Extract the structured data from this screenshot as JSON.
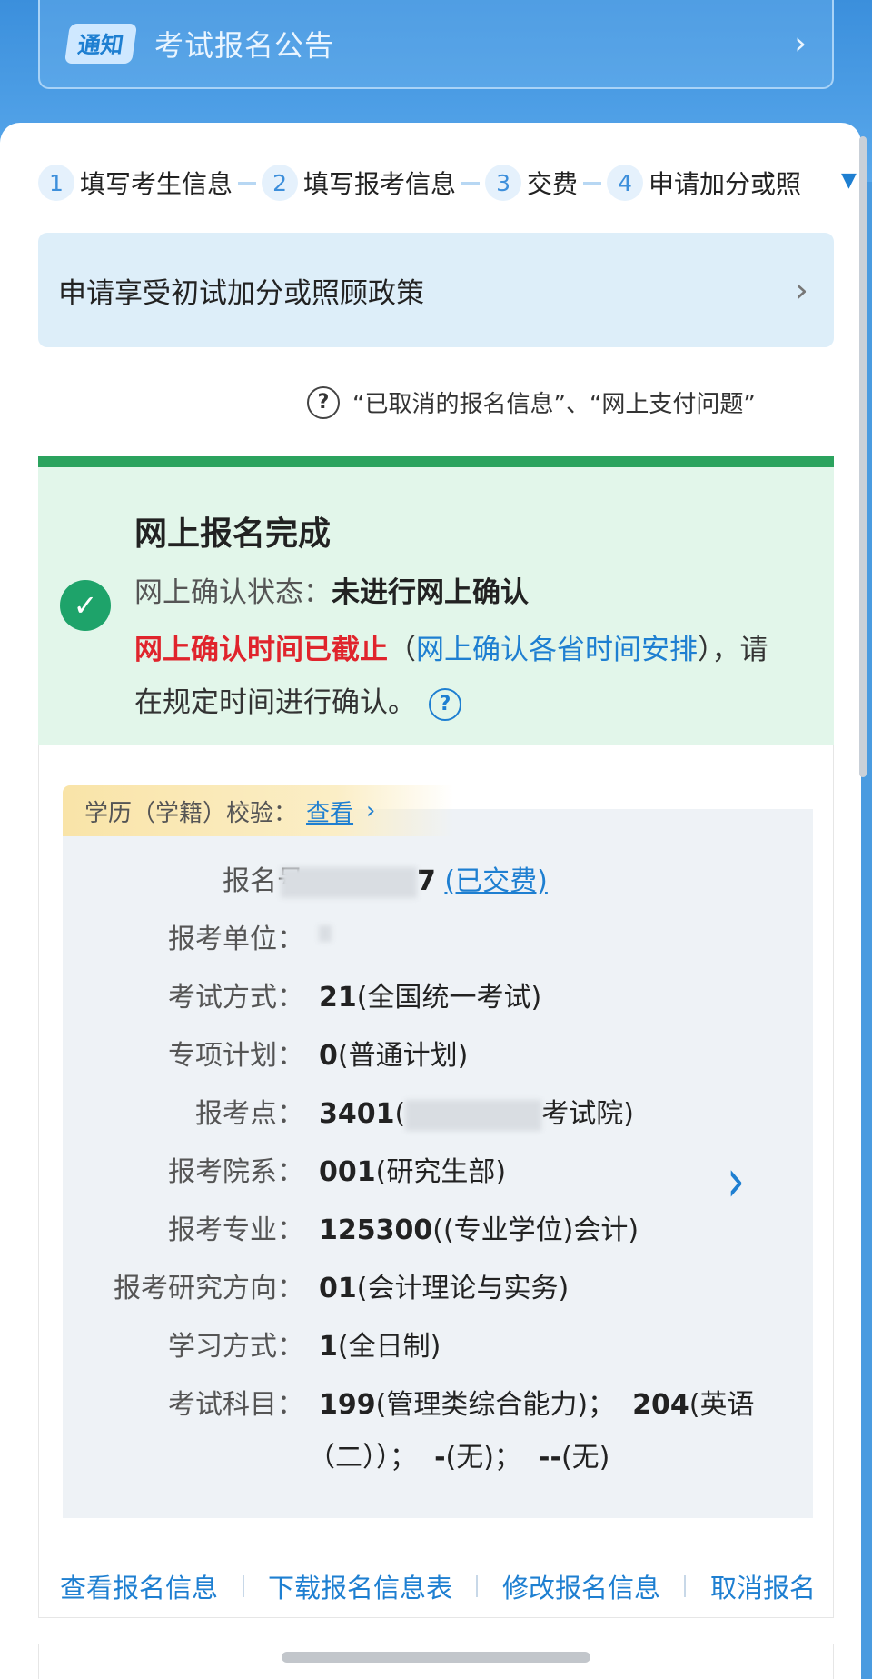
{
  "notice": {
    "tag": "通知",
    "text": "考试报名公告",
    "icon": "chevron-right-icon"
  },
  "steps": [
    {
      "num": "1",
      "label": "填写考生信息"
    },
    {
      "num": "2",
      "label": "填写报考信息"
    },
    {
      "num": "3",
      "label": "交费"
    },
    {
      "num": "4",
      "label": "申请加分或照"
    }
  ],
  "policy": {
    "text": "申请享受初试加分或照顾政策"
  },
  "help": {
    "text": "“已取消的报名信息”、“网上支付问题”"
  },
  "status": {
    "title": "网上报名完成",
    "confirm_label": "网上确认状态：",
    "confirm_value": "未进行网上确认",
    "warning": "网上确认时间已截止",
    "warn_open": "（",
    "schedule_link": "网上确认各省时间安排",
    "warn_rest": "），请在规定时间进行确认。",
    "accent": "#2ba35e",
    "warn_color": "#e0242c"
  },
  "verify": {
    "label": "学历（学籍）校验：",
    "link": "查看"
  },
  "fields": {
    "reg_no": {
      "label": "报名号",
      "tail": "7",
      "paid": "(已交费)"
    },
    "unit": {
      "label": "报考单位："
    },
    "exam_mode": {
      "label": "考试方式：",
      "code": "21",
      "text": "(全国统一考试)"
    },
    "plan": {
      "label": "专项计划：",
      "code": "0",
      "text": "(普通计划)"
    },
    "site": {
      "label": "报考点：",
      "code": "3401",
      "prefix": "(",
      "suffix": "考试院)"
    },
    "dept": {
      "label": "报考院系：",
      "code": "001",
      "text": "(研究生部)"
    },
    "major": {
      "label": "报考专业：",
      "code": "125300",
      "text": "((专业学位)会计)"
    },
    "direction": {
      "label": "报考研究方向：",
      "code": "01",
      "text": "(会计理论与实务)"
    },
    "study": {
      "label": "学习方式：",
      "code": "1",
      "text": "(全日制)"
    },
    "subjects": {
      "label": "考试科目：",
      "s1_code": "199",
      "s1_text": "(管理类综合能力)；",
      "s2_code": "204",
      "s2_text": "(英语",
      "line2_a": "（二））；",
      "s3_code": "-",
      "s3_text": "(无)；",
      "s4_code": "--",
      "s4_text": "(无)"
    }
  },
  "actions": [
    "查看报名信息",
    "下载报名信息表",
    "修改报名信息",
    "取消报名"
  ]
}
